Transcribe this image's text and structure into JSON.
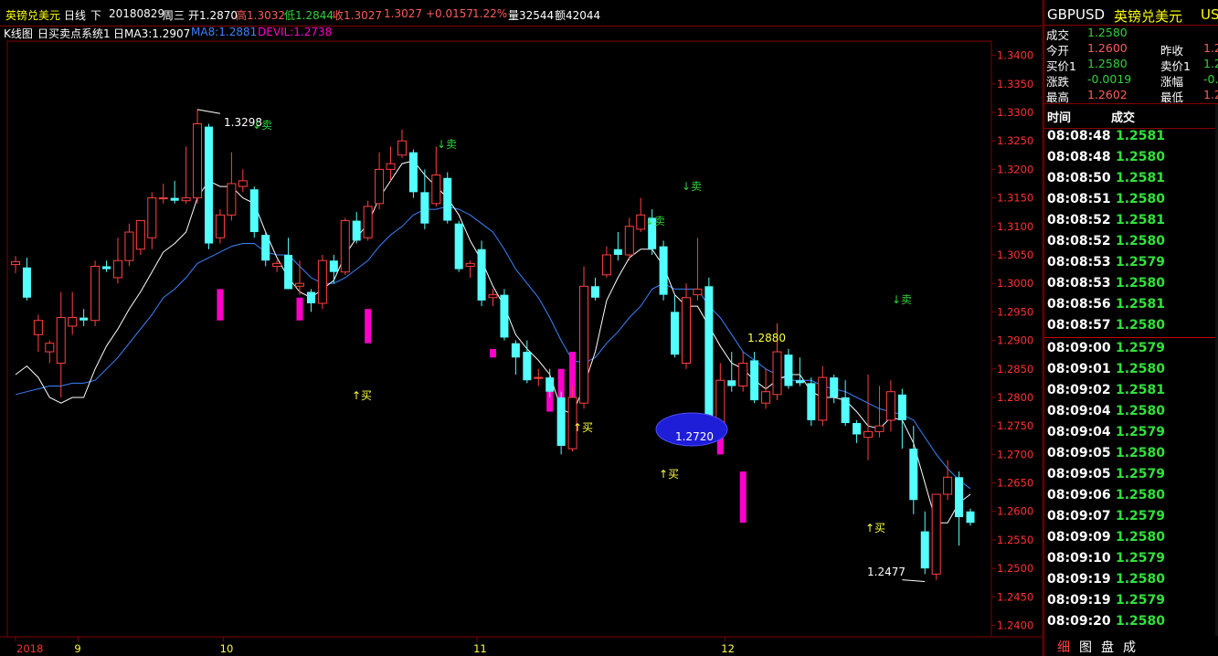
{
  "header": {
    "name": "英镑兑美元",
    "period": "日线",
    "down": "下",
    "date": "20180829",
    "weekday": "周三",
    "open": "开1.2870",
    "high": "高1.3032",
    "low": "低1.2844",
    "close": "收1.3027",
    "last": "1.3027",
    "change": "+0.0157",
    "pct": "1.22%",
    "volume": "量32544",
    "amount": "额42044"
  },
  "indicator": {
    "title": "K线图",
    "sys": "日买卖点系统1",
    "ma3": "日MA3:1.2907",
    "ma8": "MA8:1.2881",
    "devil": "DEVIL:1.2738"
  },
  "yticks": [
    "1.3400",
    "1.3350",
    "1.3300",
    "1.3250",
    "1.3200",
    "1.3150",
    "1.3100",
    "1.3050",
    "1.3000",
    "1.2950",
    "1.2900",
    "1.2850",
    "1.2800",
    "1.2750",
    "1.2700",
    "1.2650",
    "1.2600",
    "1.2550",
    "1.2500",
    "1.2450",
    "1.2400"
  ],
  "xticks": [
    {
      "label": "2018",
      "value": 0
    },
    {
      "label": "9",
      "value": 5.5
    },
    {
      "label": "10",
      "value": 18.3
    },
    {
      "label": "11",
      "value": 40.6
    },
    {
      "label": "12",
      "value": 62.4
    }
  ],
  "annotations": {
    "high": "1.3298",
    "mid": "1.2880",
    "circle": "1.2720",
    "low": "1.2477",
    "buy": "↑买",
    "sell": "↓卖"
  },
  "chart_data": {
    "type": "candlestick",
    "ylim": [
      1.238,
      1.3425
    ],
    "candles": [
      [
        1.3033,
        1.3048,
        1.3018,
        1.3038
      ],
      [
        1.3028,
        1.3045,
        1.297,
        1.2975
      ],
      [
        1.291,
        1.2945,
        1.288,
        1.2935
      ],
      [
        1.288,
        1.29,
        1.286,
        1.2895
      ],
      [
        1.286,
        1.2985,
        1.28,
        1.294
      ],
      [
        1.2925,
        1.2985,
        1.291,
        1.294
      ],
      [
        1.294,
        1.2955,
        1.2925,
        1.2935
      ],
      [
        1.2935,
        1.304,
        1.2925,
        1.303
      ],
      [
        1.303,
        1.304,
        1.302,
        1.3025
      ],
      [
        1.301,
        1.308,
        1.3,
        1.304
      ],
      [
        1.304,
        1.3105,
        1.303,
        1.309
      ],
      [
        1.306,
        1.311,
        1.305,
        1.311
      ],
      [
        1.308,
        1.316,
        1.306,
        1.315
      ],
      [
        1.315,
        1.3175,
        1.314,
        1.315
      ],
      [
        1.315,
        1.318,
        1.314,
        1.3145
      ],
      [
        1.3145,
        1.324,
        1.314,
        1.315
      ],
      [
        1.315,
        1.3305,
        1.314,
        1.328
      ],
      [
        1.3275,
        1.328,
        1.306,
        1.307
      ],
      [
        1.308,
        1.313,
        1.307,
        1.312
      ],
      [
        1.312,
        1.323,
        1.311,
        1.3175
      ],
      [
        1.317,
        1.32,
        1.316,
        1.318
      ],
      [
        1.3165,
        1.317,
        1.308,
        1.309
      ],
      [
        1.3085,
        1.309,
        1.303,
        1.304
      ],
      [
        1.303,
        1.304,
        1.302,
        1.3035
      ],
      [
        1.305,
        1.308,
        1.299,
        1.299
      ],
      [
        1.2995,
        1.304,
        1.298,
        1.3
      ],
      [
        1.2985,
        1.299,
        1.295,
        1.2965
      ],
      [
        1.2965,
        1.305,
        1.2955,
        1.304
      ],
      [
        1.304,
        1.305,
        1.3,
        1.302
      ],
      [
        1.302,
        1.3115,
        1.3015,
        1.311
      ],
      [
        1.311,
        1.3125,
        1.307,
        1.3075
      ],
      [
        1.308,
        1.3145,
        1.3075,
        1.3135
      ],
      [
        1.314,
        1.323,
        1.313,
        1.32
      ],
      [
        1.32,
        1.324,
        1.318,
        1.321
      ],
      [
        1.3225,
        1.327,
        1.322,
        1.325
      ],
      [
        1.323,
        1.3235,
        1.315,
        1.316
      ],
      [
        1.316,
        1.32,
        1.3095,
        1.3105
      ],
      [
        1.314,
        1.324,
        1.3135,
        1.319
      ],
      [
        1.3185,
        1.3195,
        1.3105,
        1.311
      ],
      [
        1.3105,
        1.311,
        1.302,
        1.3025
      ],
      [
        1.303,
        1.304,
        1.301,
        1.3035
      ],
      [
        1.306,
        1.3075,
        1.296,
        1.297
      ],
      [
        1.2975,
        1.299,
        1.296,
        1.298
      ],
      [
        1.298,
        1.299,
        1.29,
        1.2905
      ],
      [
        1.2895,
        1.29,
        1.284,
        1.287
      ],
      [
        1.288,
        1.29,
        1.2825,
        1.283
      ],
      [
        1.2835,
        1.285,
        1.282,
        1.2835
      ],
      [
        1.2835,
        1.285,
        1.28,
        1.281
      ],
      [
        1.28,
        1.281,
        1.27,
        1.2715
      ],
      [
        1.271,
        1.282,
        1.2705,
        1.28
      ],
      [
        1.279,
        1.303,
        1.278,
        1.2995
      ],
      [
        1.2995,
        1.301,
        1.297,
        1.2975
      ],
      [
        1.3015,
        1.3065,
        1.301,
        1.305
      ],
      [
        1.306,
        1.309,
        1.304,
        1.305
      ],
      [
        1.305,
        1.3115,
        1.304,
        1.31
      ],
      [
        1.3095,
        1.315,
        1.309,
        1.312
      ],
      [
        1.3115,
        1.313,
        1.305,
        1.306
      ],
      [
        1.3065,
        1.3075,
        1.297,
        1.298
      ],
      [
        1.295,
        1.298,
        1.287,
        1.2875
      ],
      [
        1.286,
        1.3,
        1.285,
        1.2975
      ],
      [
        1.298,
        1.308,
        1.297,
        1.299
      ],
      [
        1.2995,
        1.301,
        1.274,
        1.276
      ],
      [
        1.275,
        1.286,
        1.273,
        1.283
      ],
      [
        1.283,
        1.288,
        1.281,
        1.282
      ],
      [
        1.282,
        1.288,
        1.281,
        1.286
      ],
      [
        1.2865,
        1.288,
        1.279,
        1.2795
      ],
      [
        1.279,
        1.285,
        1.278,
        1.281
      ],
      [
        1.2805,
        1.293,
        1.2795,
        1.288
      ],
      [
        1.2875,
        1.2885,
        1.2815,
        1.282
      ],
      [
        1.283,
        1.287,
        1.282,
        1.2825
      ],
      [
        1.2825,
        1.2835,
        1.275,
        1.276
      ],
      [
        1.276,
        1.2855,
        1.275,
        1.2835
      ],
      [
        1.2835,
        1.284,
        1.279,
        1.28
      ],
      [
        1.28,
        1.283,
        1.275,
        1.2755
      ],
      [
        1.2755,
        1.276,
        1.272,
        1.2735
      ],
      [
        1.273,
        1.284,
        1.269,
        1.274
      ],
      [
        1.274,
        1.282,
        1.273,
        1.275
      ],
      [
        1.276,
        1.283,
        1.274,
        1.281
      ],
      [
        1.2805,
        1.2815,
        1.271,
        1.276
      ],
      [
        1.271,
        1.275,
        1.2595,
        1.262
      ],
      [
        1.2565,
        1.26,
        1.249,
        1.25
      ],
      [
        1.249,
        1.262,
        1.248,
        1.263
      ],
      [
        1.263,
        1.269,
        1.262,
        1.266
      ],
      [
        1.266,
        1.267,
        1.254,
        1.259
      ],
      [
        1.26,
        1.2605,
        1.2575,
        1.258
      ]
    ],
    "ma_white": [
      1.284,
      1.2855,
      1.2835,
      1.28,
      1.279,
      1.28,
      1.28,
      1.285,
      1.289,
      1.292,
      1.2955,
      1.2985,
      1.302,
      1.3055,
      1.307,
      1.309,
      1.315,
      1.318,
      1.317,
      1.317,
      1.315,
      1.314,
      1.309,
      1.3045,
      1.301,
      1.2985,
      1.2975,
      1.299,
      1.3005,
      1.305,
      1.308,
      1.3105,
      1.315,
      1.318,
      1.321,
      1.3215,
      1.319,
      1.317,
      1.315,
      1.312,
      1.3075,
      1.304,
      1.2995,
      1.296,
      1.291,
      1.2885,
      1.2865,
      1.284,
      1.278,
      1.277,
      1.282,
      1.288,
      1.297,
      1.301,
      1.3045,
      1.306,
      1.306,
      1.303,
      1.298,
      1.296,
      1.296,
      1.2925,
      1.289,
      1.286,
      1.285,
      1.283,
      1.2815,
      1.283,
      1.284,
      1.284,
      1.281,
      1.28,
      1.28,
      1.2795,
      1.2775,
      1.275,
      1.2745,
      1.2765,
      1.276,
      1.272,
      1.265,
      1.258,
      1.258,
      1.2615,
      1.263
    ],
    "ma_blue": [
      1.2805,
      1.281,
      1.2815,
      1.282,
      1.282,
      1.2825,
      1.2825,
      1.283,
      1.285,
      1.287,
      1.2895,
      1.292,
      1.2945,
      1.2975,
      1.299,
      1.301,
      1.3035,
      1.3045,
      1.3055,
      1.3065,
      1.307,
      1.307,
      1.3055,
      1.305,
      1.305,
      1.303,
      1.301,
      1.3,
      1.3,
      1.301,
      1.3025,
      1.304,
      1.3065,
      1.3085,
      1.31,
      1.312,
      1.313,
      1.313,
      1.3135,
      1.313,
      1.312,
      1.3105,
      1.309,
      1.306,
      1.3025,
      1.3,
      1.2975,
      1.294,
      1.29,
      1.2865,
      1.286,
      1.287,
      1.2895,
      1.2915,
      1.294,
      1.296,
      1.299,
      1.3,
      1.299,
      1.299,
      1.299,
      1.296,
      1.294,
      1.291,
      1.288,
      1.2865,
      1.285,
      1.284,
      1.283,
      1.283,
      1.283,
      1.282,
      1.2815,
      1.281,
      1.28,
      1.279,
      1.278,
      1.2775,
      1.277,
      1.276,
      1.273,
      1.27,
      1.2675,
      1.2655,
      1.264
    ],
    "devil": [
      {
        "i": 18,
        "from": 1.299,
        "to": 1.2935
      },
      {
        "i": 25,
        "from": 1.2975,
        "to": 1.2935
      },
      {
        "i": 31,
        "from": 1.2955,
        "to": 1.2895
      },
      {
        "i": 42,
        "from": 1.2885,
        "to": 1.287
      },
      {
        "i": 47,
        "from": 1.282,
        "to": 1.2775
      },
      {
        "i": 48,
        "from": 1.285,
        "to": 1.2775
      },
      {
        "i": 49,
        "from": 1.288,
        "to": 1.277
      },
      {
        "i": 62,
        "from": 1.2745,
        "to": 1.27
      },
      {
        "i": 64,
        "from": 1.267,
        "to": 1.258
      }
    ]
  },
  "side": {
    "symbol": "GBPUSD",
    "name": "英镑兑美元",
    "cut": "US",
    "quote_rows": [
      {
        "l": "成交",
        "v": "1.2580",
        "c": "#31d23a"
      },
      {
        "l": "今开",
        "v": "1.2600",
        "c": "#ff5a5a",
        "l2": "昨收",
        "v2": "1.2"
      },
      {
        "l": "买价1",
        "v": "1.2580",
        "c": "#31d23a",
        "l2": "卖价1",
        "v2": "1.2"
      },
      {
        "l": "涨跌",
        "v": "-0.0019",
        "c": "#31d23a",
        "l2": "涨幅",
        "v2": "-0."
      },
      {
        "l": "最高",
        "v": "1.2602",
        "c": "#ff5a5a",
        "l2": "最低",
        "v2": "1.2"
      }
    ],
    "tick_header": {
      "time": "时间",
      "price": "成交"
    },
    "ticks": [
      {
        "t": "08:08:48",
        "p": "1.2581"
      },
      {
        "t": "08:08:48",
        "p": "1.2580"
      },
      {
        "t": "08:08:50",
        "p": "1.2581"
      },
      {
        "t": "08:08:51",
        "p": "1.2580"
      },
      {
        "t": "08:08:52",
        "p": "1.2581"
      },
      {
        "t": "08:08:52",
        "p": "1.2580"
      },
      {
        "t": "08:08:53",
        "p": "1.2579"
      },
      {
        "t": "08:08:53",
        "p": "1.2580"
      },
      {
        "t": "08:08:56",
        "p": "1.2581"
      },
      {
        "t": "08:08:57",
        "p": "1.2580"
      },
      {
        "t": "08:09:00",
        "p": "1.2579"
      },
      {
        "t": "08:09:01",
        "p": "1.2580"
      },
      {
        "t": "08:09:02",
        "p": "1.2581"
      },
      {
        "t": "08:09:04",
        "p": "1.2580"
      },
      {
        "t": "08:09:04",
        "p": "1.2579"
      },
      {
        "t": "08:09:05",
        "p": "1.2580"
      },
      {
        "t": "08:09:05",
        "p": "1.2579"
      },
      {
        "t": "08:09:06",
        "p": "1.2580"
      },
      {
        "t": "08:09:07",
        "p": "1.2579"
      },
      {
        "t": "08:09:09",
        "p": "1.2580"
      },
      {
        "t": "08:09:10",
        "p": "1.2579"
      },
      {
        "t": "08:09:19",
        "p": "1.2580"
      },
      {
        "t": "08:09:19",
        "p": "1.2579"
      },
      {
        "t": "08:09:20",
        "p": "1.2580"
      }
    ],
    "tabs": [
      "细",
      "图",
      "盘",
      "成"
    ]
  },
  "colors": {
    "up": "#ff4040",
    "down": "#54ffff",
    "grid": "#800000",
    "devil": "#ff00c8",
    "buy": "#ffff40",
    "sell": "#2fd23a",
    "ma3": "#ffffff",
    "ma8": "#3c82ff"
  }
}
